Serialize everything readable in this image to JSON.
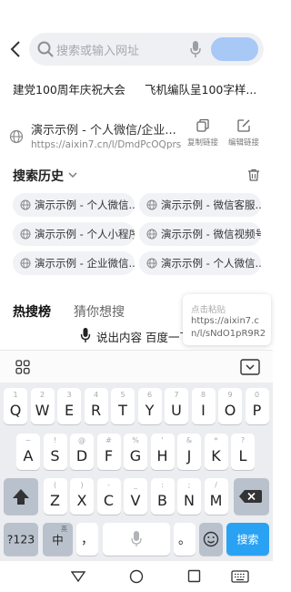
{
  "search": {
    "placeholder": "搜索或输入网址"
  },
  "hot_links": [
    "建党100周年庆祝大会",
    "飞机编队呈100字样..."
  ],
  "clipboard": {
    "title": "演示示例 - 个人微信/企业...",
    "url": "https://aixin7.cn/l/DmdPcOQprs",
    "copy_label": "复制链接",
    "edit_label": "编辑链接"
  },
  "history": {
    "title": "搜索历史",
    "items": [
      "演示示例 - 个人微信...",
      "演示示例 - 微信客服...",
      "演示示例 - 个人小程序",
      "演示示例 - 微信视频号",
      "演示示例 - 企业微信...",
      "演示示例 - 个人微信..."
    ]
  },
  "tabs": [
    "热搜榜",
    "猜你想搜"
  ],
  "paste": {
    "label": "点击粘贴",
    "text": "https://aixin7.cn/l/sNdO1pR9R2"
  },
  "voice": {
    "text": "说出内容 百度一下"
  },
  "keyboard": {
    "row1": [
      {
        "k": "Q",
        "s": "1"
      },
      {
        "k": "W",
        "s": "2"
      },
      {
        "k": "E",
        "s": "3"
      },
      {
        "k": "R",
        "s": "4"
      },
      {
        "k": "T",
        "s": "5"
      },
      {
        "k": "Y",
        "s": "6"
      },
      {
        "k": "U",
        "s": "7"
      },
      {
        "k": "I",
        "s": "8"
      },
      {
        "k": "O",
        "s": "9"
      },
      {
        "k": "P",
        "s": "0"
      }
    ],
    "row2": [
      {
        "k": "A",
        "s": "~"
      },
      {
        "k": "S",
        "s": "!"
      },
      {
        "k": "D",
        "s": "@"
      },
      {
        "k": "F",
        "s": "#"
      },
      {
        "k": "G",
        "s": "%"
      },
      {
        "k": "H",
        "s": "'"
      },
      {
        "k": "J",
        "s": "&"
      },
      {
        "k": "K",
        "s": "*"
      },
      {
        "k": "L",
        "s": "?"
      }
    ],
    "row3": [
      {
        "k": "Z",
        "s": "("
      },
      {
        "k": "X",
        "s": ")"
      },
      {
        "k": "C",
        "s": "-"
      },
      {
        "k": "V",
        "s": "_"
      },
      {
        "k": "B",
        "s": ":"
      },
      {
        "k": "N",
        "s": ";"
      },
      {
        "k": "M",
        "s": "/"
      }
    ],
    "num_label": "?123",
    "lang_label": "中",
    "lang_sub": "英",
    "punct_label": "，",
    "punct2_label": "。",
    "search_label": "搜索"
  },
  "colors": {
    "accent": "#2aa2f4",
    "search_button": "#a8c8f6"
  }
}
